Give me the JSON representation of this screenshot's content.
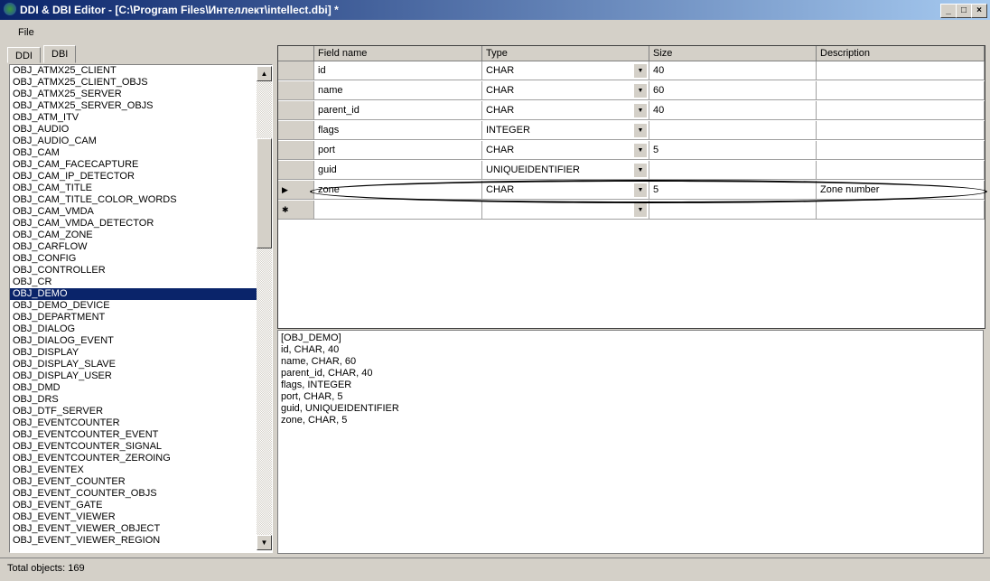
{
  "window": {
    "title": "DDI & DBI Editor - [C:\\Program Files\\Интеллект\\intellect.dbi] *",
    "min": "_",
    "max": "□",
    "close": "×"
  },
  "menu": {
    "file": "File"
  },
  "tabs": [
    {
      "label": "DDI"
    },
    {
      "label": "DBI"
    }
  ],
  "objects": [
    "OBJ_ATMX25_CLIENT",
    "OBJ_ATMX25_CLIENT_OBJS",
    "OBJ_ATMX25_SERVER",
    "OBJ_ATMX25_SERVER_OBJS",
    "OBJ_ATM_ITV",
    "OBJ_AUDIO",
    "OBJ_AUDIO_CAM",
    "OBJ_CAM",
    "OBJ_CAM_FACECAPTURE",
    "OBJ_CAM_IP_DETECTOR",
    "OBJ_CAM_TITLE",
    "OBJ_CAM_TITLE_COLOR_WORDS",
    "OBJ_CAM_VMDA",
    "OBJ_CAM_VMDA_DETECTOR",
    "OBJ_CAM_ZONE",
    "OBJ_CARFLOW",
    "OBJ_CONFIG",
    "OBJ_CONTROLLER",
    "OBJ_CR",
    "OBJ_DEMO",
    "OBJ_DEMO_DEVICE",
    "OBJ_DEPARTMENT",
    "OBJ_DIALOG",
    "OBJ_DIALOG_EVENT",
    "OBJ_DISPLAY",
    "OBJ_DISPLAY_SLAVE",
    "OBJ_DISPLAY_USER",
    "OBJ_DMD",
    "OBJ_DRS",
    "OBJ_DTF_SERVER",
    "OBJ_EVENTCOUNTER",
    "OBJ_EVENTCOUNTER_EVENT",
    "OBJ_EVENTCOUNTER_SIGNAL",
    "OBJ_EVENTCOUNTER_ZEROING",
    "OBJ_EVENTEX",
    "OBJ_EVENT_COUNTER",
    "OBJ_EVENT_COUNTER_OBJS",
    "OBJ_EVENT_GATE",
    "OBJ_EVENT_VIEWER",
    "OBJ_EVENT_VIEWER_OBJECT",
    "OBJ_EVENT_VIEWER_REGION"
  ],
  "selected_object": "OBJ_DEMO",
  "grid": {
    "columns": [
      "Field name",
      "Type",
      "Size",
      "Description"
    ],
    "rows": [
      {
        "field": "id",
        "type": "CHAR",
        "size": "40",
        "desc": ""
      },
      {
        "field": "name",
        "type": "CHAR",
        "size": "60",
        "desc": ""
      },
      {
        "field": "parent_id",
        "type": "CHAR",
        "size": "40",
        "desc": ""
      },
      {
        "field": "flags",
        "type": "INTEGER",
        "size": "",
        "desc": ""
      },
      {
        "field": "port",
        "type": "CHAR",
        "size": "5",
        "desc": ""
      },
      {
        "field": "guid",
        "type": "UNIQUEIDENTIFIER",
        "size": "",
        "desc": ""
      },
      {
        "field": "zone",
        "type": "CHAR",
        "size": "5",
        "desc": "Zone number",
        "current": true
      },
      {
        "field": "",
        "type": "",
        "size": "",
        "desc": "",
        "new": true
      }
    ]
  },
  "definition": [
    "[OBJ_DEMO]",
    "id, CHAR, 40",
    "name, CHAR, 60",
    "parent_id, CHAR, 40",
    "flags, INTEGER",
    "port, CHAR, 5",
    "guid, UNIQUEIDENTIFIER",
    "zone, CHAR, 5"
  ],
  "status": "Total objects: 169"
}
